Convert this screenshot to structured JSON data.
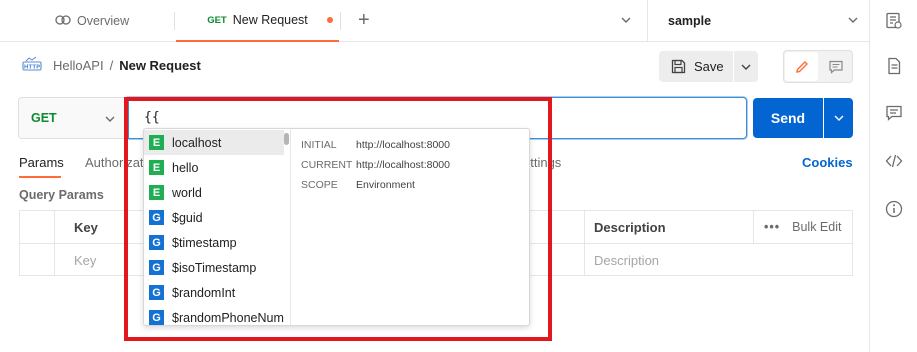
{
  "tabs": {
    "overview": "Overview",
    "active_method": "GET",
    "active_name": "New Request"
  },
  "environment": {
    "selected": "sample"
  },
  "breadcrumb": {
    "collection": "HelloAPI",
    "separator": "/",
    "request": "New Request"
  },
  "toolbar": {
    "save_label": "Save"
  },
  "url_bar": {
    "method": "GET",
    "value": "{{",
    "send_label": "Send"
  },
  "request_tabs": {
    "params": "Params",
    "authorization": "Authorizat",
    "settings": "ettings",
    "cookies": "Cookies"
  },
  "query_params": {
    "title": "Query Params",
    "headers": {
      "key": "Key",
      "description": "Description",
      "bulk_edit": "Bulk Edit"
    },
    "placeholder": {
      "key": "Key",
      "description": "Description"
    }
  },
  "autocomplete": {
    "items": [
      {
        "badge": "E",
        "label": "localhost"
      },
      {
        "badge": "E",
        "label": "hello"
      },
      {
        "badge": "E",
        "label": "world"
      },
      {
        "badge": "G",
        "label": "$guid"
      },
      {
        "badge": "G",
        "label": "$timestamp"
      },
      {
        "badge": "G",
        "label": "$isoTimestamp"
      },
      {
        "badge": "G",
        "label": "$randomInt"
      },
      {
        "badge": "G",
        "label": "$randomPhoneNuml"
      }
    ],
    "info": {
      "initial_key": "INITIAL",
      "initial_val": "http://localhost:8000",
      "current_key": "CURRENT",
      "current_val": "http://localhost:8000",
      "scope_key": "SCOPE",
      "scope_val": "Environment"
    }
  },
  "colors": {
    "accent": "#ff6c37",
    "primary": "#0265d2",
    "env_badge": "#1fae52",
    "global_badge": "#1472d4",
    "highlight": "#e3171e"
  },
  "icons": [
    "overview-icon",
    "plus-icon",
    "chevron-down-icon",
    "environment-quicklook-icon",
    "documentation-icon",
    "comments-icon",
    "code-icon",
    "info-icon",
    "http-icon",
    "save-icon",
    "pencil-icon",
    "comment-icon"
  ]
}
